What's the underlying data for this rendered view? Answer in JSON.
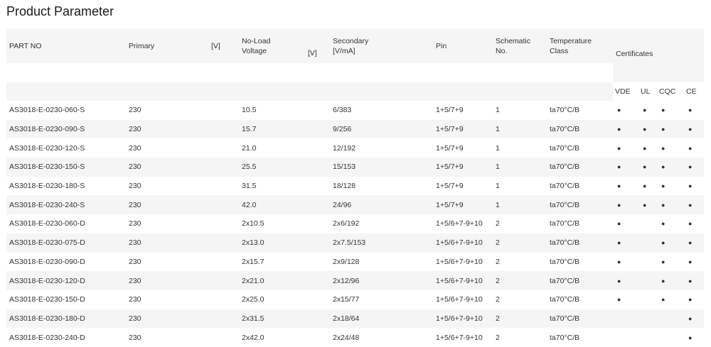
{
  "page_title": "Product Parameter",
  "headers": {
    "part_no": "PART NO",
    "primary": "Primary",
    "primary_unit": "[V]",
    "no_load_line1": "No-Load",
    "no_load_line2": "Voltage",
    "no_load_unit": "[V]",
    "secondary_line1": "Secondary",
    "secondary_line2": "[V/mA]",
    "pin": "Pin",
    "schematic_line1": "Schematic",
    "schematic_line2": "No.",
    "temperature_line1": "Temperature",
    "temperature_line2": "Class",
    "certificates": "Certificates",
    "cert_vde": "VDE",
    "cert_ul": "UL",
    "cert_cqc": "CQC",
    "cert_ce": "CE"
  },
  "rows": [
    {
      "part_no": "AS3018-E-0230-060-S",
      "primary": "230",
      "no_load": "10.5",
      "secondary": "6/383",
      "pin": "1+5/7+9",
      "schematic": "1",
      "temperature": "ta70°C/B",
      "vde": "●",
      "ul": "●",
      "cqc": "●",
      "ce": "●"
    },
    {
      "part_no": "AS3018-E-0230-090-S",
      "primary": "230",
      "no_load": "15.7",
      "secondary": "9/256",
      "pin": "1+5/7+9",
      "schematic": "1",
      "temperature": "ta70°C/B",
      "vde": "●",
      "ul": "●",
      "cqc": "●",
      "ce": "●"
    },
    {
      "part_no": "AS3018-E-0230-120-S",
      "primary": "230",
      "no_load": "21.0",
      "secondary": "12/192",
      "pin": "1+5/7+9",
      "schematic": "1",
      "temperature": "ta70°C/B",
      "vde": "●",
      "ul": "●",
      "cqc": "●",
      "ce": "●"
    },
    {
      "part_no": "AS3018-E-0230-150-S",
      "primary": "230",
      "no_load": "25.5",
      "secondary": "15/153",
      "pin": "1+5/7+9",
      "schematic": "1",
      "temperature": "ta70°C/B",
      "vde": "●",
      "ul": "●",
      "cqc": "●",
      "ce": "●"
    },
    {
      "part_no": "AS3018-E-0230-180-S",
      "primary": "230",
      "no_load": "31.5",
      "secondary": "18/128",
      "pin": "1+5/7+9",
      "schematic": "1",
      "temperature": "ta70°C/B",
      "vde": "●",
      "ul": "●",
      "cqc": "●",
      "ce": "●"
    },
    {
      "part_no": "AS3018-E-0230-240-S",
      "primary": "230",
      "no_load": "42.0",
      "secondary": "24/96",
      "pin": "1+5/7+9",
      "schematic": "1",
      "temperature": "ta70°C/B",
      "vde": "●",
      "ul": "●",
      "cqc": "●",
      "ce": "●"
    },
    {
      "part_no": "AS3018-E-0230-060-D",
      "primary": "230",
      "no_load": "2x10.5",
      "secondary": "2x6/192",
      "pin": "1+5/6+7-9+10",
      "schematic": "2",
      "temperature": "ta70°C/B",
      "vde": "●",
      "ul": "",
      "cqc": "●",
      "ce": "●"
    },
    {
      "part_no": "AS3018-E-0230-075-D",
      "primary": "230",
      "no_load": "2x13.0",
      "secondary": "2x7.5/153",
      "pin": "1+5/6+7-9+10",
      "schematic": "2",
      "temperature": "ta70°C/B",
      "vde": "●",
      "ul": "",
      "cqc": "●",
      "ce": "●"
    },
    {
      "part_no": "AS3018-E-0230-090-D",
      "primary": "230",
      "no_load": "2x15.7",
      "secondary": "2x9/128",
      "pin": "1+5/6+7-9+10",
      "schematic": "2",
      "temperature": "ta70°C/B",
      "vde": "●",
      "ul": "",
      "cqc": "●",
      "ce": "●"
    },
    {
      "part_no": "AS3018-E-0230-120-D",
      "primary": "230",
      "no_load": "2x21.0",
      "secondary": "2x12/96",
      "pin": "1+5/6+7-9+10",
      "schematic": "2",
      "temperature": "ta70°C/B",
      "vde": "●",
      "ul": "",
      "cqc": "●",
      "ce": "●"
    },
    {
      "part_no": "AS3018-E-0230-150-D",
      "primary": "230",
      "no_load": "2x25.0",
      "secondary": "2x15/77",
      "pin": "1+5/6+7-9+10",
      "schematic": "2",
      "temperature": "ta70°C/B",
      "vde": "●",
      "ul": "",
      "cqc": "●",
      "ce": "●"
    },
    {
      "part_no": "AS3018-E-0230-180-D",
      "primary": "230",
      "no_load": "2x31.5",
      "secondary": "2x18/64",
      "pin": "1+5/6+7-9+10",
      "schematic": "2",
      "temperature": "ta70°C/B",
      "vde": "",
      "ul": "",
      "cqc": "",
      "ce": "●"
    },
    {
      "part_no": "AS3018-E-0230-240-D",
      "primary": "230",
      "no_load": "2x42.0",
      "secondary": "2x24/48",
      "pin": "1+5/6+7-9+10",
      "schematic": "2",
      "temperature": "ta70°C/B",
      "vde": "",
      "ul": "",
      "cqc": "",
      "ce": "●"
    }
  ]
}
